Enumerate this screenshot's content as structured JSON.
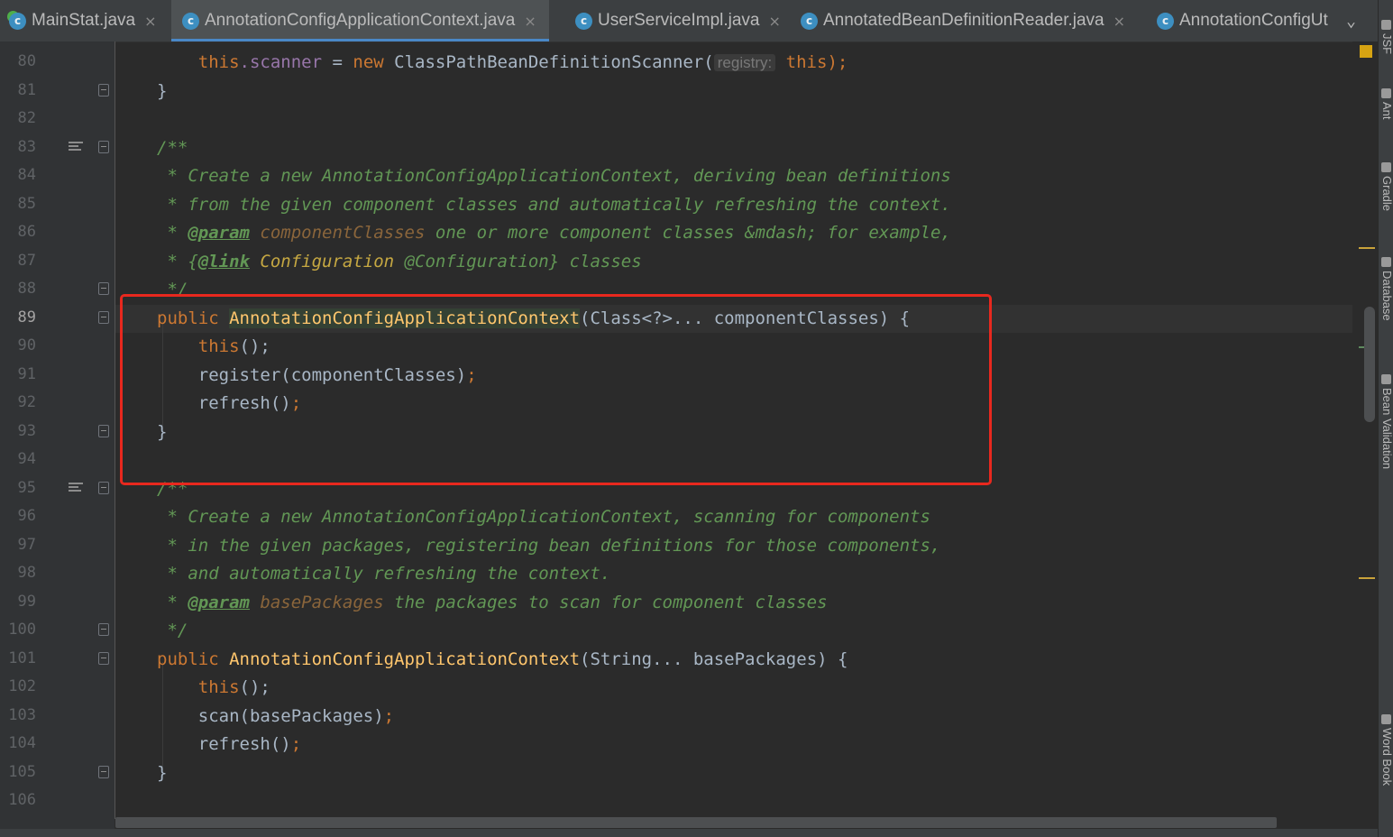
{
  "tabs": [
    {
      "label": "MainStat.java",
      "icon": "java-class-icon",
      "active": false
    },
    {
      "label": "AnnotationConfigApplicationContext.java",
      "icon": "java-class-icon",
      "active": true
    },
    {
      "label": "UserServiceImpl.java",
      "icon": "java-class-icon",
      "active": false
    },
    {
      "label": "AnnotatedBeanDefinitionReader.java",
      "icon": "java-class-icon",
      "active": false
    },
    {
      "label": "AnnotationConfigUt",
      "icon": "java-class-icon",
      "active": false
    }
  ],
  "tab_close_glyph": "×",
  "tab_overflow_glyph": "⌄",
  "tool_windows": [
    "JSF",
    "Ant",
    "Gradle",
    "Database",
    "Bean Validation",
    "Word Book"
  ],
  "editor": {
    "current_line": "89",
    "lines": [
      {
        "num": "80"
      },
      {
        "num": "81"
      },
      {
        "num": "82"
      },
      {
        "num": "83"
      },
      {
        "num": "84"
      },
      {
        "num": "85"
      },
      {
        "num": "86"
      },
      {
        "num": "87"
      },
      {
        "num": "88"
      },
      {
        "num": "89"
      },
      {
        "num": "90"
      },
      {
        "num": "91"
      },
      {
        "num": "92"
      },
      {
        "num": "93"
      },
      {
        "num": "94"
      },
      {
        "num": "95"
      },
      {
        "num": "96"
      },
      {
        "num": "97"
      },
      {
        "num": "98"
      },
      {
        "num": "99"
      },
      {
        "num": "100"
      },
      {
        "num": "101"
      },
      {
        "num": "102"
      },
      {
        "num": "103"
      },
      {
        "num": "104"
      },
      {
        "num": "105"
      },
      {
        "num": "106"
      }
    ],
    "code": {
      "l80": {
        "this": "this",
        "dot_scanner": ".scanner",
        "eq": " = ",
        "new": "new",
        "cls": " ClassPathBeanDefinitionScanner(",
        "hint": "registry:",
        "arg": "this",
        "end": ");"
      },
      "l81": "}",
      "l83": "/**",
      "l84": " * Create a new AnnotationConfigApplicationContext, deriving bean definitions",
      "l85": " * from the given component classes and automatically refreshing the context.",
      "l86": {
        "star": " * ",
        "tag": "@param",
        "param": " componentClasses",
        "rest": " one or more component classes &mdash; for example,"
      },
      "l87": {
        "star": " * {",
        "tag": "@link",
        "ref": " Configuration",
        "rest": " @Configuration} classes"
      },
      "l88": " */",
      "l89": {
        "kw": "public",
        "name": "AnnotationConfigApplicationContext",
        "rest": "(Class<?>... componentClasses) {"
      },
      "l90": {
        "kw": "this",
        "rest": "();"
      },
      "l91": {
        "call": "register(componentClasses)",
        "semi": ";"
      },
      "l92": {
        "call": "refresh()",
        "semi": ";"
      },
      "l93": "}",
      "l95": "/**",
      "l96": " * Create a new AnnotationConfigApplicationContext, scanning for components",
      "l97": " * in the given packages, registering bean definitions for those components,",
      "l98": " * and automatically refreshing the context.",
      "l99": {
        "star": " * ",
        "tag": "@param",
        "param": " basePackages",
        "rest": " the packages to scan for component classes"
      },
      "l100": " */",
      "l101": {
        "kw": "public",
        "name": "AnnotationConfigApplicationContext",
        "rest": "(String... basePackages) {"
      },
      "l102": {
        "kw": "this",
        "rest": "();"
      },
      "l103": {
        "call": "scan(basePackages)",
        "semi": ";"
      },
      "l104": {
        "call": "refresh()",
        "semi": ";"
      },
      "l105": "}"
    }
  },
  "colors": {
    "editor_bg": "#2b2b2b",
    "keyword": "#cc7832",
    "javadoc": "#629755",
    "method_decl": "#ffc66d",
    "field": "#9876aa",
    "highlight_box": "#e8281e",
    "active_tab_underline": "#4a88c7"
  }
}
